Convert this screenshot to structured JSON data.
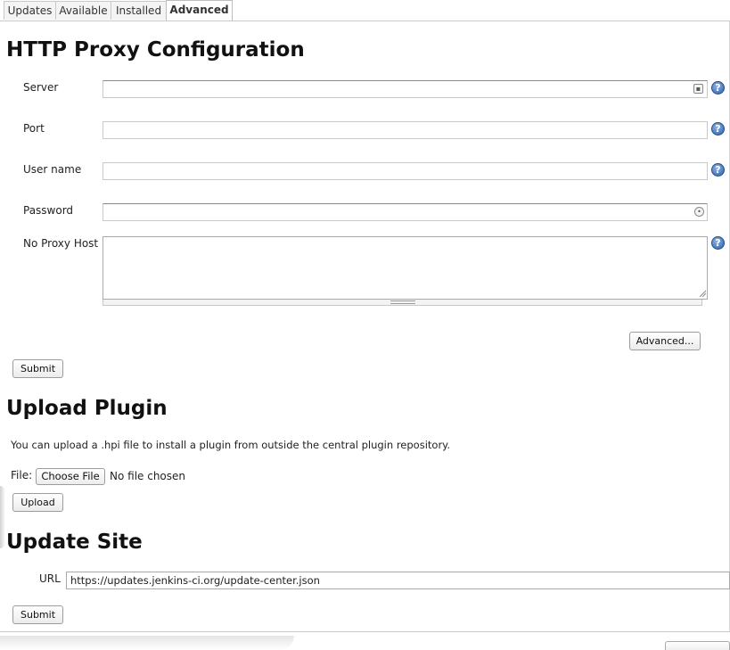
{
  "tabs": [
    {
      "label": "Updates",
      "active": false
    },
    {
      "label": "Available",
      "active": false
    },
    {
      "label": "Installed",
      "active": false
    },
    {
      "label": "Advanced",
      "active": true
    }
  ],
  "proxy": {
    "title": "HTTP Proxy Configuration",
    "server_label": "Server",
    "server_value": "",
    "port_label": "Port",
    "port_value": "",
    "username_label": "User name",
    "username_value": "",
    "password_label": "Password",
    "password_value": "",
    "no_proxy_label": "No Proxy Host",
    "no_proxy_value": "",
    "advanced_button": "Advanced...",
    "submit_button": "Submit"
  },
  "upload": {
    "title": "Upload Plugin",
    "description": "You can upload a .hpi file to install a plugin from outside the central plugin repository.",
    "file_label": "File:",
    "choose_button": "Choose File",
    "no_file_text": "No file chosen",
    "upload_button": "Upload"
  },
  "update_site": {
    "title": "Update Site",
    "url_label": "URL",
    "url_value": "https://updates.jenkins-ci.org/update-center.json",
    "submit_button": "Submit"
  },
  "help_icon_glyph": "?",
  "icons": {
    "help": "help-icon",
    "contact_card": "contact-card-icon",
    "password_key": "password-key-icon"
  }
}
